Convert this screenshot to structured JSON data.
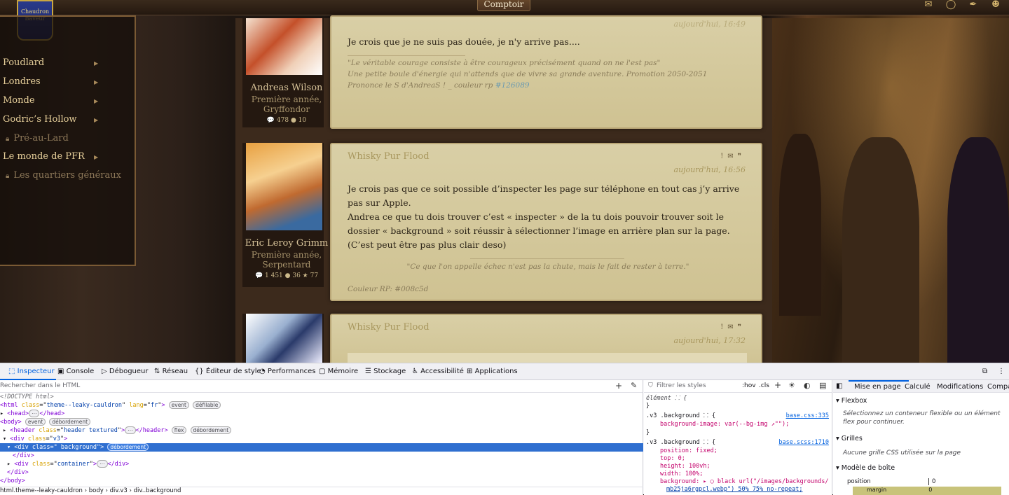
{
  "site": {
    "logo_text": "Chaudron Baveur",
    "top_button": "Comptoir",
    "top_icons": [
      "scroll-icon",
      "ring-icon",
      "quill-icon",
      "avatar-icon"
    ],
    "nav": [
      {
        "label": "Poudlard",
        "locked": false,
        "arrow": true
      },
      {
        "label": "Londres",
        "locked": false,
        "arrow": true
      },
      {
        "label": "Monde",
        "locked": false,
        "arrow": true
      },
      {
        "label": "Godric’s Hollow",
        "locked": false,
        "arrow": true
      },
      {
        "label": "Pré-au-Lard",
        "locked": true,
        "arrow": false
      },
      {
        "label": "Le monde de PFR",
        "locked": false,
        "arrow": true
      },
      {
        "label": "Les quartiers généraux",
        "locked": true,
        "arrow": false
      }
    ]
  },
  "posts": [
    {
      "author": "Andreas Wilson",
      "rank": "Première année, Gryffondor",
      "stats": "💬 478 ● 10",
      "date": "aujourd'hui, 16:49",
      "body": "Je crois que je ne suis pas douée, je n'y arrive pas....",
      "sig1": "\"Le véritable courage consiste à être courageux précisément quand on ne l'est pas\"",
      "sig2": "Une petite boule d'énergie qui n'attends que de vivre sa grande aventure. Promotion 2050-2051",
      "sig3": "Prononce le S d'AndreaS ! _ couleur rp ",
      "sig3_link": "#126089"
    },
    {
      "title": "Whisky Pur Flood",
      "author": "Eric Leroy Grimm",
      "rank": "Première année, Serpentard",
      "stats": "💬 1 451 ● 36 ★ 77",
      "date": "aujourd'hui, 16:56",
      "body1": "Je crois pas que ce soit possible d’inspecter les page sur téléphone en tout cas j’y arrive pas sur Apple.",
      "body2": "Andrea ce que tu dois trouver c’est « inspecter » de la tu dois pouvoir trouver soit le dossier « background » soit réussir à sélectionner l’image en arrière plan sur la page. (C’est peut être pas plus clair deso)",
      "sig": "\"Ce que l'on appelle échec n'est pas la chute, mais le fait de rester à terre.\"",
      "color": "Couleur RP: #008c5d"
    },
    {
      "title": "Whisky Pur Flood",
      "date": "aujourd'hui, 17:32"
    }
  ],
  "card_icons": "! ✉ ❞",
  "devtools": {
    "tabs": [
      "Inspecteur",
      "Console",
      "Débogueur",
      "Réseau",
      "Éditeur de style",
      "Performances",
      "Mémoire",
      "Stockage",
      "Accessibilité",
      "Applications"
    ],
    "search_html": "Rechercher dans le HTML",
    "filter_styles": "Filtrer les styles",
    "hov": ":hov",
    "cls": ".cls",
    "right_tabs": [
      "Mise en page",
      "Calculé",
      "Modifications",
      "Compat"
    ],
    "flexbox_title": "Flexbox",
    "flexbox_text": "Sélectionnez un conteneur flexible ou un élément flex pour continuer.",
    "grids_title": "Grilles",
    "grids_text": "Aucune grille CSS utilisée sur la page",
    "boxmodel_title": "Modèle de boîte",
    "position_label": "position",
    "position_value": "0",
    "margin_label": "margin",
    "margin_value": "0",
    "breadcrumb": "html.theme--leaky-cauldron  ›  body  ›  div.v3  ›  div..background",
    "element_rule": "élément ⸬ {",
    "rule1_selector": ".v3 .background ⸬ {",
    "rule1_link": "base.css:335",
    "rule1_prop": "background-image: var(--bg-img ↗\"\");",
    "rule2_selector": ".v3 .background ⸬ {",
    "rule2_link": "base.scss:1710",
    "rule2_props": [
      "position: fixed;",
      "top: 0;",
      "height: 100vh;",
      "width: 100%;",
      "background: ▸ ◯ black url(\"/images/backgrounds/",
      "mb25ja6rgpcl.webp\") 50% 75% no-repeat;"
    ]
  }
}
